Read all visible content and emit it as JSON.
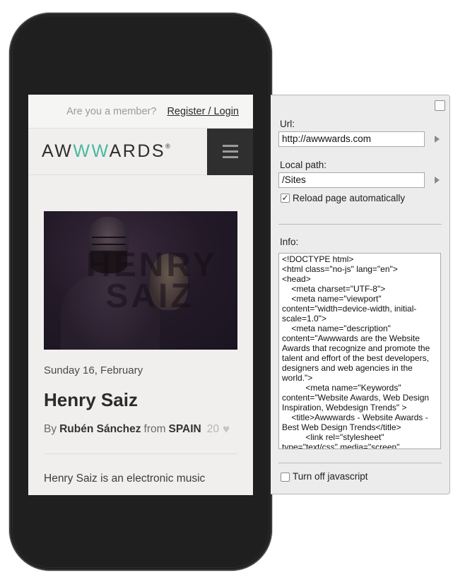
{
  "site": {
    "member_question": "Are you a member?",
    "member_link": "Register / Login",
    "logo_prefix": "AW",
    "logo_accent": "WW",
    "logo_suffix": "ARDS",
    "logo_mark": "®",
    "menu_icon": "hamburger-menu-icon",
    "hero_overlay_text": "HENRY\nSAIZ",
    "post_date": "Sunday 16, February",
    "post_title": "Henry Saiz",
    "post_by": "By",
    "post_author": "Rubén Sánchez",
    "post_from": "from",
    "post_country": "SPAIN",
    "post_likes": "20",
    "post_excerpt": "Henry Saiz is an electronic music"
  },
  "panel": {
    "url_label": "Url:",
    "url_value": "http://awwwards.com",
    "path_label": "Local path:",
    "path_value": "/Sites",
    "reload_label": "Reload page automatically",
    "reload_checked": true,
    "info_label": "Info:",
    "info_text": "<!DOCTYPE html>\n<html class=\"no-js\" lang=\"en\">\n<head>\n    <meta charset=\"UTF-8\">\n    <meta name=\"viewport\" content=\"width=device-width, initial-scale=1.0\">\n    <meta name=\"description\" content=\"Awwwards are the Website Awards that recognize and promote the talent and effort of the best developers, designers and web agencies in the world.\">\n          <meta name=\"Keywords\" content=\"Website Awards, Web Design Inspiration, Webdesign Trends\" >\n    <title>Awwwards - Website Awards - Best Web Design Trends</title>\n          <link rel=\"stylesheet\" type=\"text/css\" media=\"screen\" href=\"/css/",
    "js_label": "Turn off javascript",
    "js_checked": false
  },
  "colors": {
    "accent": "#49b8a0",
    "phone_body": "#1f1f1f",
    "menu_button": "#2f2f2f"
  }
}
